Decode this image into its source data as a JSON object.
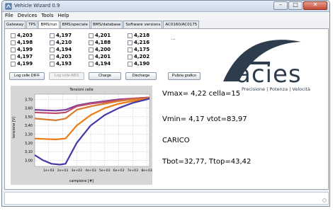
{
  "window": {
    "title": "Vehicle Wizard 0.9"
  },
  "menu": [
    "File",
    "Devices",
    "Tools",
    "Help"
  ],
  "tabs": [
    {
      "label": "Gateway"
    },
    {
      "label": "TPS"
    },
    {
      "label": "BMS/run",
      "active": true
    },
    {
      "label": "BMS/speciale"
    },
    {
      "label": "BMS/database"
    },
    {
      "label": "Software versions"
    },
    {
      "label": "AC0160/AC0175"
    }
  ],
  "cells": [
    [
      "4,203",
      "4,198",
      "4,199",
      "4,197",
      "4,199"
    ],
    [
      "4,197",
      "4,210",
      "4,194",
      "4,203",
      "4,193"
    ],
    [
      "4,201",
      "4,188",
      "4,200",
      "4,201",
      "4,194"
    ],
    [
      "4,218",
      "4,216",
      "4,175",
      "4,202",
      "4,190"
    ]
  ],
  "cells_more": "...",
  "buttons": {
    "log_diff": "Log celle DIFF",
    "log_abs": "Log celle ABS",
    "charge": "Charge",
    "discharge": "Discharge",
    "clear_chart": "Pulizia grafico"
  },
  "logo": {
    "wordmark": "acies",
    "tagline": "Precisione | Potenza | Velocità",
    "color": "#2e3d4d"
  },
  "chart_data": {
    "type": "line",
    "title": "Tensioni celle",
    "xlabel": "campione [#]",
    "ylabel": "tensione [V]",
    "yticks": [
      "3,70",
      "3,60",
      "3,50",
      "3,40",
      "3,30",
      "3,20",
      "3,10",
      "3,00"
    ],
    "xticks": [
      "1e+03",
      "2e+03",
      "3e+03",
      "4e+03",
      "5e+03",
      "6e+03",
      "7e+03",
      "8e+03"
    ],
    "xlim": [
      0,
      8200
    ],
    "ylim": [
      2.93,
      3.76
    ],
    "grid": true,
    "series": [
      {
        "color": "#7a3f9a",
        "x": [
          0,
          1500,
          2200,
          3000,
          4000,
          5000,
          6000,
          7000,
          8000,
          8200
        ],
        "y": [
          3.58,
          3.57,
          3.58,
          3.63,
          3.66,
          3.68,
          3.7,
          3.71,
          3.72,
          3.72
        ]
      },
      {
        "color": "#c34b6e",
        "x": [
          0,
          1500,
          2200,
          3000,
          4000,
          5000,
          6000,
          7000,
          8000,
          8200
        ],
        "y": [
          3.55,
          3.54,
          3.55,
          3.62,
          3.65,
          3.67,
          3.69,
          3.71,
          3.72,
          3.72
        ]
      },
      {
        "color": "#d77a2d",
        "x": [
          0,
          1500,
          2200,
          3000,
          4000,
          5000,
          6000,
          7000,
          8000,
          8200
        ],
        "y": [
          3.48,
          3.46,
          3.48,
          3.58,
          3.62,
          3.65,
          3.68,
          3.7,
          3.71,
          3.72
        ]
      },
      {
        "color": "#ee7a12",
        "x": [
          0,
          1500,
          2200,
          3000,
          4000,
          5000,
          6000,
          7000,
          8000,
          8200
        ],
        "y": [
          3.25,
          3.24,
          3.25,
          3.4,
          3.52,
          3.6,
          3.65,
          3.68,
          3.7,
          3.71
        ]
      },
      {
        "color": "#4338a8",
        "x": [
          0,
          600,
          1200,
          1800,
          2200,
          3000,
          4000,
          5000,
          6000,
          7000,
          8000,
          8200
        ],
        "y": [
          3.06,
          3.0,
          2.96,
          2.95,
          2.96,
          3.2,
          3.4,
          3.52,
          3.6,
          3.66,
          3.7,
          3.71
        ]
      }
    ]
  },
  "readouts": {
    "vmax": "Vmax= 4,22 cella=15",
    "vmin": "Vmin= 4,17 vtot=83,97",
    "state": "CARICO",
    "temps": "Tbot=32,77, Ttop=43,42"
  }
}
